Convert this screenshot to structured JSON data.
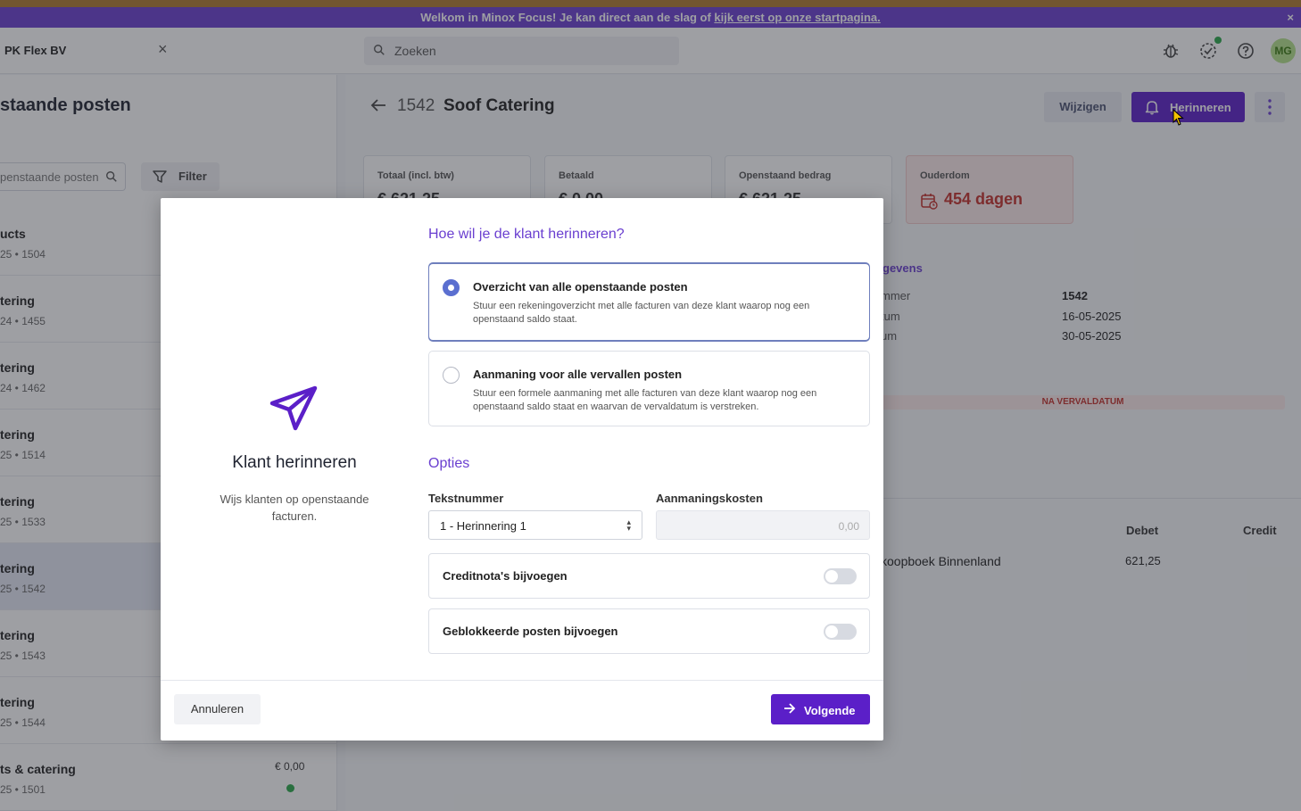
{
  "banner": {
    "text": "Welkom in Minox Focus! Je kan direct aan de slag of ",
    "link": "kijk eerst op onze startpagina.",
    "close": "×"
  },
  "appbar": {
    "company": "PK Flex BV",
    "company_close": "×",
    "search_placeholder": "Zoeken",
    "avatar": "MG"
  },
  "left": {
    "title": "staande posten",
    "search_placeholder": "penstaande posten",
    "filter_label": "Filter",
    "rows": [
      {
        "name": "ucts",
        "meta": "25 • 1504",
        "amount": "",
        "selected": false
      },
      {
        "name": "tering",
        "meta": "24 • 1455",
        "amount": "",
        "selected": false
      },
      {
        "name": "tering",
        "meta": "24 • 1462",
        "amount": "",
        "selected": false
      },
      {
        "name": "tering",
        "meta": "25 • 1514",
        "amount": "",
        "selected": false
      },
      {
        "name": "tering",
        "meta": "25 • 1533",
        "amount": "",
        "selected": false
      },
      {
        "name": "tering",
        "meta": "25 • 1542",
        "amount": "",
        "selected": true
      },
      {
        "name": "tering",
        "meta": "25 • 1543",
        "amount": "",
        "selected": false
      },
      {
        "name": "tering",
        "meta": "25 • 1544",
        "amount": "",
        "selected": false
      },
      {
        "name": "ts & catering",
        "meta": "25 • 1501",
        "amount": "€ 0,00",
        "selected": false,
        "paid": true
      }
    ]
  },
  "detail": {
    "number": "1542",
    "name": "Soof Catering",
    "edit_label": "Wijzigen",
    "remind_label": "Herinneren",
    "stats": [
      {
        "label": "Totaal (incl. btw)",
        "value": "€ 621,25"
      },
      {
        "label": "Betaald",
        "value": "€ 0,00"
      },
      {
        "label": "Openstaand bedrag",
        "value": "€ 621,25"
      },
      {
        "label": "Ouderdom",
        "value": "454 dagen"
      }
    ],
    "gegevens_title": "gevens",
    "fields": [
      {
        "label": "mmer",
        "value": "1542"
      },
      {
        "label": "tum",
        "value": "16-05-2025"
      },
      {
        "label": "um",
        "value": "30-05-2025"
      }
    ],
    "status": "NA VERVALDATUM",
    "table": {
      "headers": [
        "Debet",
        "Credit"
      ],
      "row": {
        "account": "koopboek Binnenland",
        "debet": "621,25",
        "credit": ""
      }
    }
  },
  "modal": {
    "title": "Klant herinneren",
    "description": "Wijs klanten op openstaande facturen.",
    "question": "Hoe wil je de klant herinneren?",
    "options": [
      {
        "title": "Overzicht van alle openstaande posten",
        "desc": "Stuur een rekeningoverzicht met alle facturen van deze klant waarop nog een openstaand saldo staat.",
        "selected": true
      },
      {
        "title": "Aanmaning voor alle vervallen posten",
        "desc": "Stuur een formele aanmaning met alle facturen van deze klant waarop nog een openstaand saldo staat en waarvan de vervaldatum is verstreken.",
        "selected": false
      }
    ],
    "options_title": "Opties",
    "text_number_label": "Tekstnummer",
    "text_number_value": "1 - Herinnering 1",
    "costs_label": "Aanmaningskosten",
    "costs_value": "0,00",
    "toggles": [
      {
        "label": "Creditnota's bijvoegen",
        "on": false
      },
      {
        "label": "Geblokkeerde posten bijvoegen",
        "on": false
      }
    ],
    "cancel_label": "Annuleren",
    "next_label": "Volgende"
  },
  "colors": {
    "accent": "#5b1fc8",
    "banner": "#6a3fd0",
    "danger": "#c4302b",
    "success": "#2aa84a"
  }
}
